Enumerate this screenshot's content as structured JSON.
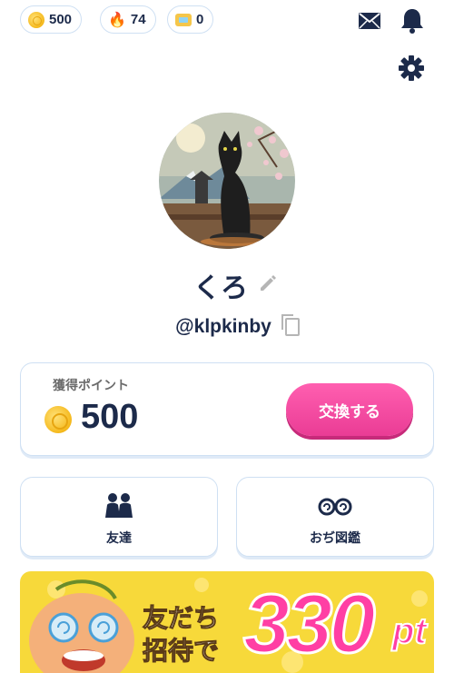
{
  "status": {
    "coins": "500",
    "streak": "74",
    "tickets": "0"
  },
  "profile": {
    "name": "くろ",
    "handle": "@klpkinby"
  },
  "points_card": {
    "label": "獲得ポイント",
    "value": "500",
    "exchange_label": "交換する"
  },
  "tiles": {
    "friends_label": "友達",
    "zukan_label": "おぢ図鑑"
  },
  "banner": {
    "line1": "友だち",
    "line2": "招待で",
    "amount": "330",
    "unit": "pt"
  },
  "colors": {
    "accent_pink": "#ea3c95",
    "navy": "#1c2a4a",
    "border_blue": "#cfe0f3",
    "banner_yellow": "#f7d93a"
  },
  "icons": [
    "coin-icon",
    "flame-icon",
    "ticket-icon",
    "mail-icon",
    "bell-icon",
    "gear-icon",
    "edit-icon",
    "copy-icon",
    "friends-icon",
    "glasses-icon"
  ]
}
